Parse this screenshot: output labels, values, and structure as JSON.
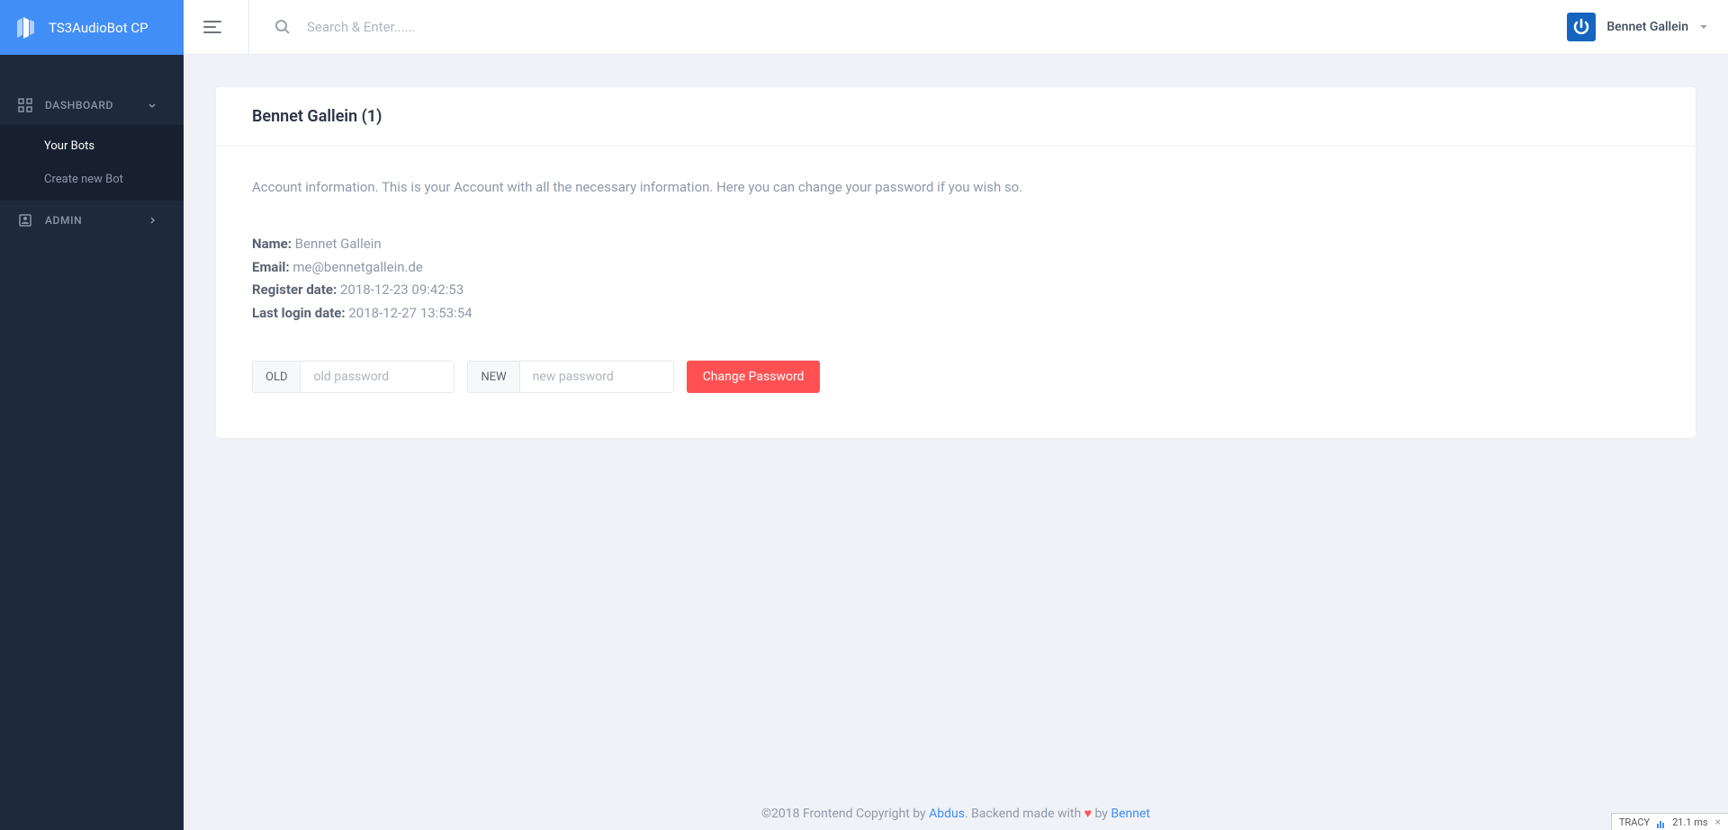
{
  "brand": {
    "title": "TS3AudioBot CP"
  },
  "search": {
    "placeholder": "Search & Enter......"
  },
  "user": {
    "name": "Bennet Gallein"
  },
  "nav": {
    "dashboard": {
      "label": "DASHBOARD"
    },
    "your_bots": {
      "label": "Your Bots"
    },
    "create_bot": {
      "label": "Create new Bot"
    },
    "admin": {
      "label": "ADMIN"
    }
  },
  "card": {
    "title": "Bennet Gallein (1)",
    "intro": "Account information. This is your Account with all the necessary information. Here you can change your password if you wish so.",
    "name_label": "Name:",
    "name_value": "Bennet Gallein",
    "email_label": "Email:",
    "email_value": "me@bennetgallein.de",
    "reg_label": "Register date:",
    "reg_value": "2018-12-23 09:42:53",
    "login_label": "Last login date:",
    "login_value": "2018-12-27 13:53:54"
  },
  "form": {
    "old_label": "OLD",
    "old_placeholder": "old password",
    "new_label": "NEW",
    "new_placeholder": "new password",
    "button": "Change Password"
  },
  "footer": {
    "copyright": "©2018 Frontend Copyright by ",
    "link1": "Abdus",
    "middle": ". Backend made with ",
    "heart": "♥",
    "by": " by ",
    "link2": "Bennet"
  },
  "tracy": {
    "label": "TRACY",
    "time": "21.1 ms",
    "close": "×"
  }
}
